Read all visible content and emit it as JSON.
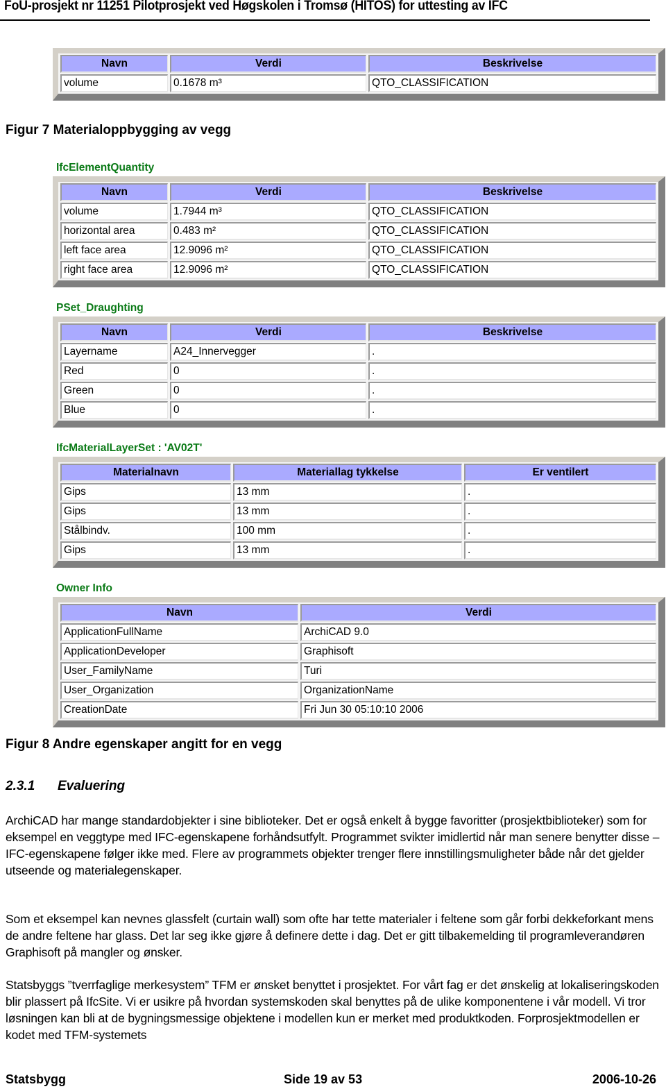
{
  "header": {
    "title": "FoU-prosjekt nr 11251 Pilotprosjekt ved Høgskolen i Tromsø (HITOS) for uttesting av IFC"
  },
  "table_top": {
    "columns": [
      "Navn",
      "Verdi",
      "Beskrivelse"
    ],
    "rows": [
      [
        "volume",
        "0.1678 m³",
        "QTO_CLASSIFICATION"
      ]
    ]
  },
  "figure7_caption": "Figur 7 Materialoppbygging av vegg",
  "element_quantity": {
    "label": "IfcElementQuantity",
    "columns": [
      "Navn",
      "Verdi",
      "Beskrivelse"
    ],
    "rows": [
      [
        "volume",
        "1.7944 m³",
        "QTO_CLASSIFICATION"
      ],
      [
        "horizontal area",
        "0.483 m²",
        "QTO_CLASSIFICATION"
      ],
      [
        "left face area",
        "12.9096 m²",
        "QTO_CLASSIFICATION"
      ],
      [
        "right face area",
        "12.9096 m²",
        "QTO_CLASSIFICATION"
      ]
    ]
  },
  "pset_draughting": {
    "label": "PSet_Draughting",
    "columns": [
      "Navn",
      "Verdi",
      "Beskrivelse"
    ],
    "rows": [
      [
        "Layername",
        "A24_Innervegger",
        "."
      ],
      [
        "Red",
        "0",
        "."
      ],
      [
        "Green",
        "0",
        "."
      ],
      [
        "Blue",
        "0",
        "."
      ]
    ]
  },
  "material_layer_set": {
    "label": "IfcMaterialLayerSet : 'AV02T'",
    "columns": [
      "Materialnavn",
      "Materiallag tykkelse",
      "Er ventilert"
    ],
    "rows": [
      [
        "Gips",
        "13 mm",
        "."
      ],
      [
        "Gips",
        "13 mm",
        "."
      ],
      [
        "Stålbindv.",
        "100 mm",
        "."
      ],
      [
        "Gips",
        "13 mm",
        "."
      ]
    ]
  },
  "owner_info": {
    "label": "Owner Info",
    "columns": [
      "Navn",
      "Verdi"
    ],
    "rows": [
      [
        "ApplicationFullName",
        "ArchiCAD 9.0"
      ],
      [
        "ApplicationDeveloper",
        "Graphisoft"
      ],
      [
        "User_FamilyName",
        "Turi"
      ],
      [
        "User_Organization",
        "OrganizationName"
      ],
      [
        "CreationDate",
        "Fri Jun 30 05:10:10 2006"
      ]
    ]
  },
  "figure8_caption": "Figur 8 Andre egenskaper angitt for en vegg",
  "section": {
    "number": "2.3.1",
    "title": "Evaluering"
  },
  "paragraphs": [
    "ArchiCAD har mange standardobjekter i sine biblioteker. Det er også enkelt å bygge favoritter (prosjektbiblioteker) som for eksempel en veggtype med IFC-egenskapene forhåndsutfylt. Programmet svikter imidlertid når man senere benytter disse – IFC-egenskapene følger ikke med. Flere av programmets objekter trenger flere innstillingsmuligheter både når det gjelder utseende og materialegenskaper.",
    "Som et eksempel kan nevnes glassfelt (curtain wall) som ofte har tette materialer i feltene som går forbi dekkeforkant mens de andre feltene har glass. Det lar seg ikke gjøre å definere dette i dag. Det er gitt tilbakemelding til programleverandøren Graphisoft på mangler og ønsker.",
    "Statsbyggs ”tverrfaglige merkesystem” TFM er ønsket benyttet i prosjektet. For vårt fag er det ønskelig at lokaliseringskoden blir plassert på IfcSite. Vi er usikre på hvordan systemskoden skal benyttes på de ulike komponentene i vår modell. Vi tror løsningen kan bli at de bygningsmessige objektene i modellen kun er merket med produktkoden. Forprosjektmodellen er kodet med TFM-systemets"
  ],
  "footer": {
    "left": "Statsbygg",
    "center": "Side 19 av 53",
    "right": "2006-10-26"
  }
}
